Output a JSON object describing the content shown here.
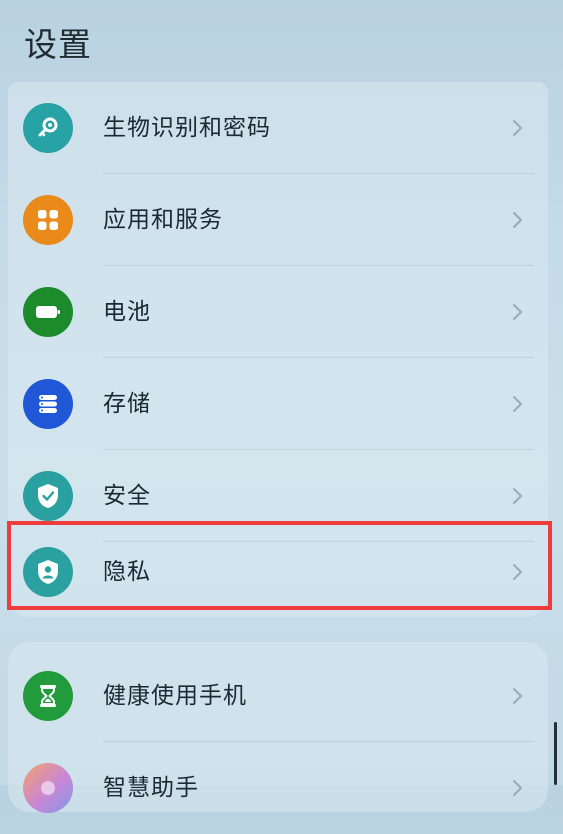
{
  "header": {
    "title": "设置"
  },
  "colors": {
    "background": "#c4dbe8",
    "highlight_border": "#ee3b3b",
    "biometrics_icon_bg": "#27a3a6",
    "apps_icon_bg": "#e98a1a",
    "battery_icon_bg": "#1d8a2c",
    "storage_icon_bg": "#1f57d6",
    "security_icon_bg": "#2aa1a0",
    "privacy_icon_bg": "#2aa1a0",
    "digital_balance_icon_bg": "#219b3b",
    "assistant_icon_bg": "#c985d6"
  },
  "settings_group_1": [
    {
      "label": "生物识别和密码",
      "icon": "key-icon"
    },
    {
      "label": "应用和服务",
      "icon": "apps-grid-icon"
    },
    {
      "label": "电池",
      "icon": "battery-icon"
    },
    {
      "label": "存储",
      "icon": "storage-icon"
    },
    {
      "label": "安全",
      "icon": "shield-check-icon"
    },
    {
      "label": "隐私",
      "icon": "privacy-shield-icon"
    }
  ],
  "settings_group_2": [
    {
      "label": "健康使用手机",
      "icon": "hourglass-icon"
    },
    {
      "label": "智慧助手",
      "icon": "assistant-icon"
    }
  ],
  "highlighted_item": "隐私"
}
